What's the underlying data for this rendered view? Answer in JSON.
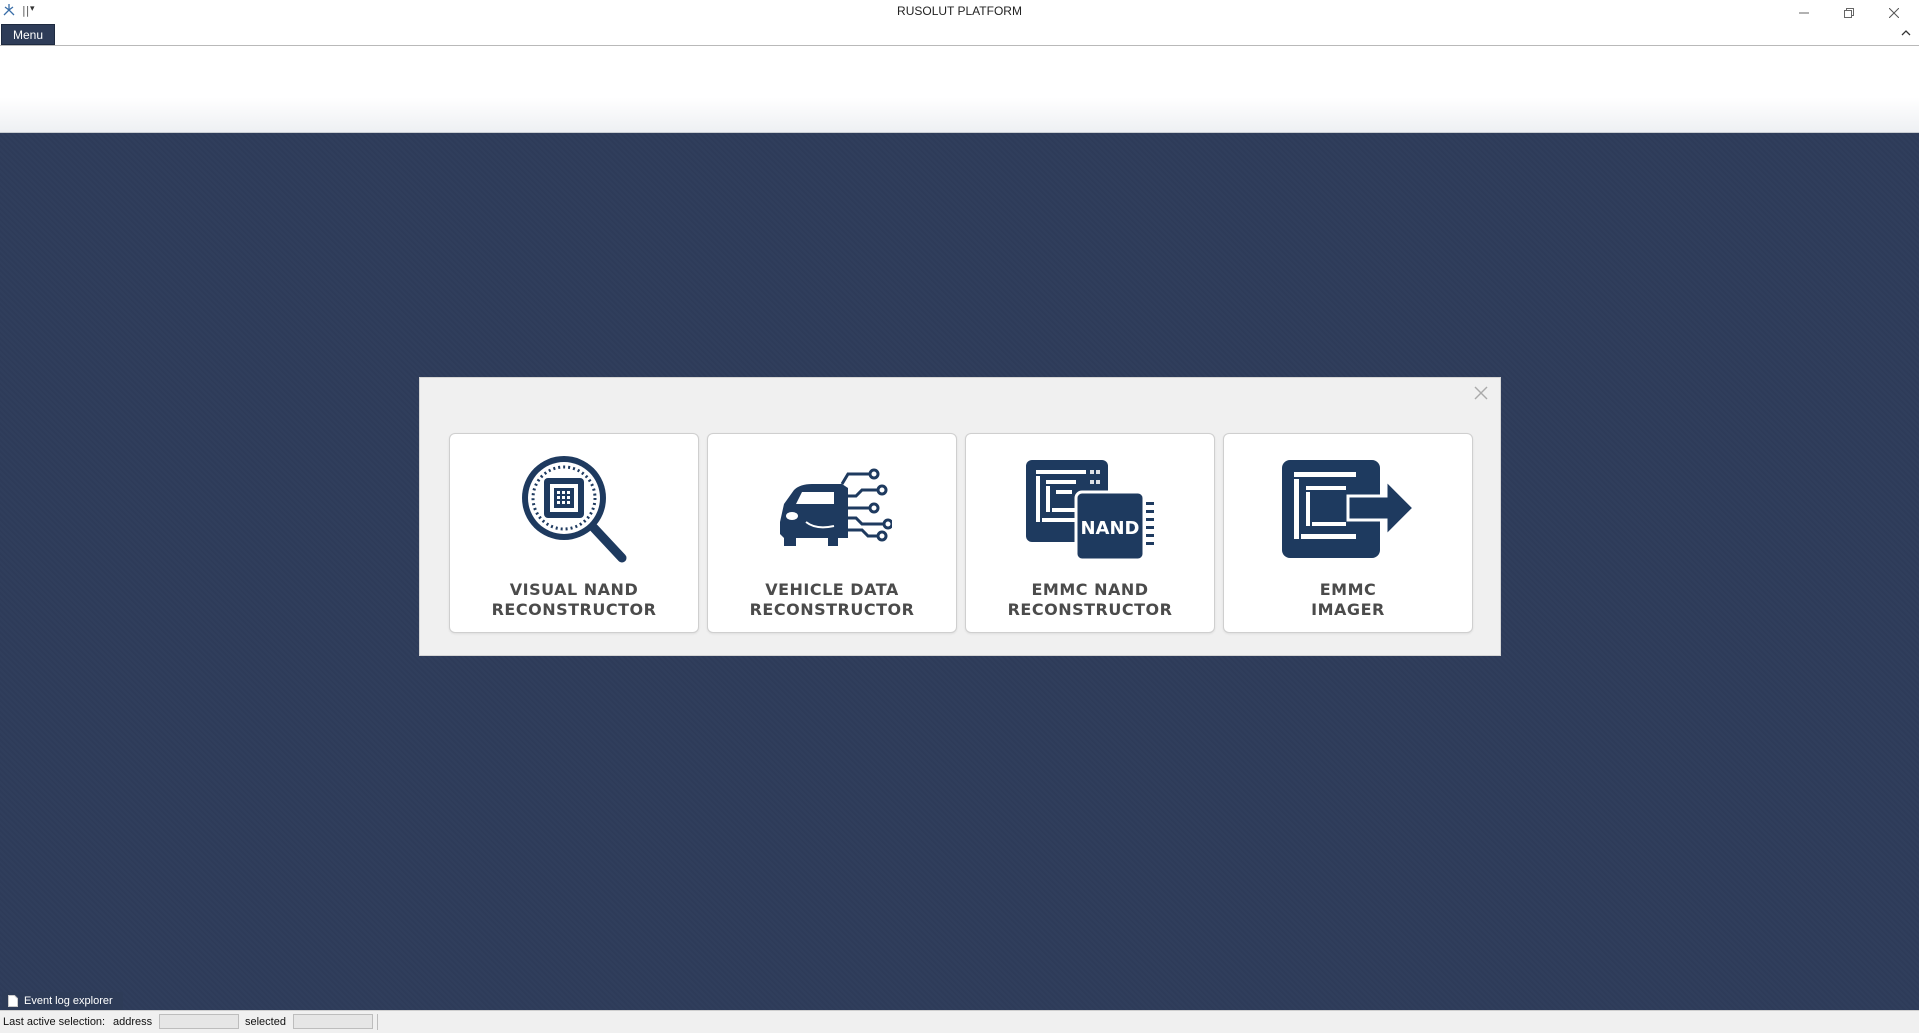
{
  "window": {
    "title": "RUSOLUT PLATFORM",
    "qat_separator": "||",
    "qat_dropdown": "▾"
  },
  "menu": {
    "label": "Menu"
  },
  "launcher": {
    "cards": [
      {
        "line1": "VISUAL NAND",
        "line2": "RECONSTRUCTOR",
        "icon": "magnifier-chip-icon"
      },
      {
        "line1": "VEHICLE DATA",
        "line2": "RECONSTRUCTOR",
        "icon": "car-circuit-icon"
      },
      {
        "line1": "EMMC NAND",
        "line2": "RECONSTRUCTOR",
        "icon": "emmc-nand-chip-icon",
        "chip_text": "NAND"
      },
      {
        "line1": "EMMC",
        "line2": "IMAGER",
        "icon": "emmc-imager-icon"
      }
    ]
  },
  "event_log": {
    "label": "Event log explorer"
  },
  "statusbar": {
    "last_active_label": "Last active selection:",
    "address_label": "address",
    "address_value": "",
    "selected_label": "selected",
    "selected_value": ""
  },
  "colors": {
    "workspace": "#2e3c5a",
    "icon": "#1e3a5f",
    "card_text": "#4b4b4b",
    "tab": "#2e3c58"
  }
}
